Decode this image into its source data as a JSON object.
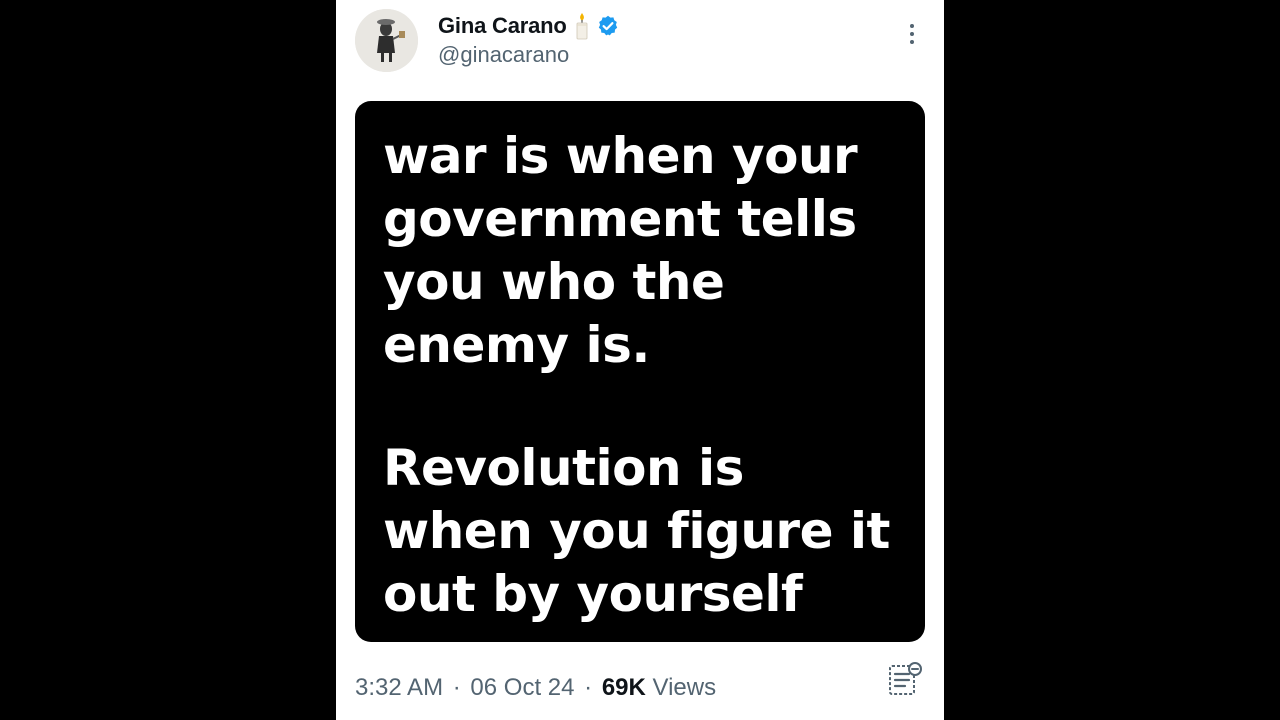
{
  "tweet": {
    "author": {
      "display_name": "Gina Carano",
      "handle": "@ginacarano",
      "name_emoji_icon": "candle-icon",
      "verified_icon": "verified-badge-icon",
      "verified_color": "#1d9bf0"
    },
    "media": {
      "quote_lines": [
        "war is when your",
        "government tells",
        "you who the",
        "enemy is.",
        "Revolution is",
        "when you figure it",
        "out by yourself"
      ]
    },
    "meta": {
      "time": "3:32 AM",
      "separator": "·",
      "date": "06 Oct 24",
      "views_count": "69K",
      "views_label": "Views"
    },
    "colors": {
      "text_primary": "#0f1419",
      "text_secondary": "#536471",
      "background": "#ffffff",
      "letterbox": "#000000"
    }
  }
}
